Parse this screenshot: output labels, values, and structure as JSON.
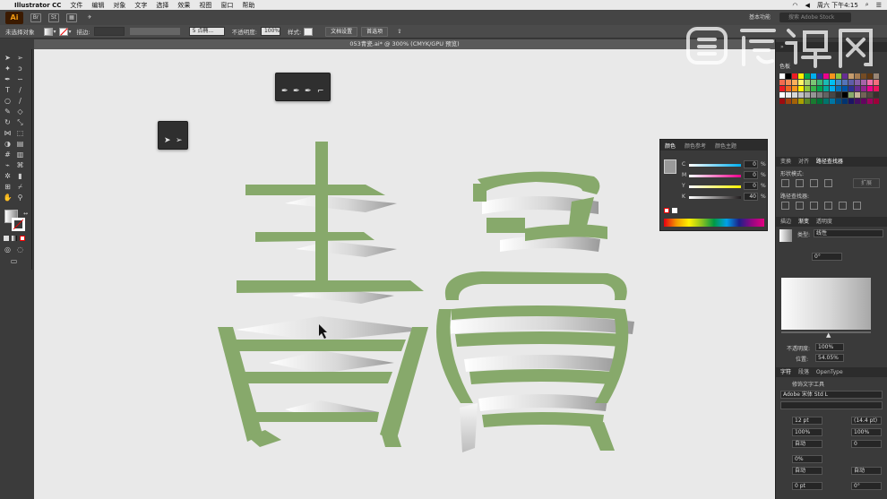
{
  "menubar": {
    "app_name": "Illustrator CC",
    "items": [
      "文件",
      "编辑",
      "对象",
      "文字",
      "选择",
      "效果",
      "视图",
      "窗口",
      "帮助"
    ],
    "right_text": "周六 下午4:15"
  },
  "appbar": {
    "logo": "Ai",
    "workspace": "基本功能",
    "search_placeholder": "搜索 Adobe Stock",
    "icons": [
      "bridge-icon",
      "stock-icon",
      "arrange-icon",
      "gpu-icon"
    ]
  },
  "control_bar": {
    "selection_label": "未选择对象",
    "stroke_label": "描边:",
    "stroke_value": "",
    "brush_label": "5 点椭...",
    "opacity_label": "不透明度:",
    "opacity_value": "100%",
    "style_label": "样式:",
    "doc_setup_button": "文档设置",
    "prefs_button": "首选项"
  },
  "document": {
    "tab_title": "053青瓷.ai* @ 300% (CMYK/GPU 预览)"
  },
  "color_panel": {
    "tabs": [
      "颜色",
      "颜色参考",
      "颜色主题"
    ],
    "channels": [
      {
        "label": "C",
        "value": "0",
        "color": "#00aeef"
      },
      {
        "label": "M",
        "value": "0",
        "color": "#ec008c"
      },
      {
        "label": "Y",
        "value": "0",
        "color": "#fff200"
      },
      {
        "label": "K",
        "value": "40",
        "color": "#231f20"
      }
    ],
    "unit": "%"
  },
  "dock": {
    "swatches_title": "色板",
    "transform_tabs": [
      "变换",
      "对齐",
      "路径查找器"
    ],
    "shape_modes_label": "形状模式:",
    "expand_button": "扩展",
    "pathfinder_label": "路径查找器:",
    "gradient_tabs": [
      "描边",
      "渐变",
      "透明度"
    ],
    "gradient_type_label": "类型:",
    "gradient_type_value": "线性",
    "gradient_angle": "0°",
    "gradient_aspect": "",
    "opacity_label": "不透明度:",
    "opacity_value": "100%",
    "location_label": "位置:",
    "location_value": "54.05%",
    "char_tabs": [
      "字符",
      "段落",
      "OpenType"
    ],
    "touch_type_tool": "修饰文字工具",
    "font_name": "Adobe 宋体 Std L",
    "font_size": "12 pt",
    "leading": "(14.4 pt)",
    "h_scale": "100%",
    "v_scale": "100%",
    "kerning": "自动",
    "tracking": "0",
    "tsume": "0%",
    "aki_left": "自动",
    "aki_right": "自动",
    "baseline": "0 pt",
    "rotate": "0°"
  },
  "canvas": {
    "ribbon_color": "#87a96b"
  },
  "watermark": {
    "text": "虎课网"
  }
}
